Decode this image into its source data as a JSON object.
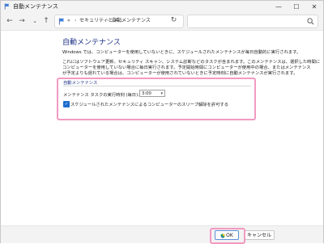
{
  "window": {
    "title": "自動メンテナンス",
    "icon": "flag-icon",
    "controls": {
      "minimize": "—",
      "maximize": "☐",
      "close": "✕"
    }
  },
  "nav": {
    "back": "←",
    "forward": "→",
    "recent": "⌄",
    "up": "↑",
    "breadcrumb": [
      "«",
      "セキュリティとメ...",
      "自動メンテナンス"
    ],
    "breadcrumb_separator": "›",
    "address_dropdown": "⌄",
    "refresh": "↻",
    "search_placeholder": ""
  },
  "content": {
    "heading": "自動メンテナンス",
    "paragraph1": "Windows では、コンピューターを使用していないときに、スケジュールされたメンテナンスが毎日自動的に実行されます。",
    "paragraph2_lines": [
      "これにはソフトウェア更新、セキュリティ スキャン、システム診断などのタスクが含まれます。このメンテナンスは、選択した時間に",
      "コンピューターを使用していない場合に毎日実行されます。予定開始時間にコンピューターが使用中の場合、またはメンテナンス",
      "が予定よりも遅れている場合は、コンピューターが使用されていないときに予定時刻に自動メンテナンスが実行されます。"
    ],
    "group": {
      "title": "自動メンテナンス",
      "time_label": "メンテナンス タスクの実行時刻 (毎日):",
      "time_value": "3:00",
      "wake_checked": true,
      "wake_label": "スケジュールされたメンテナンスによるコンピューターのスリープ解除を許可する"
    }
  },
  "footer": {
    "ok_label": "OK",
    "cancel_label": "キャンセル"
  },
  "colors": {
    "heading": "#1e3287",
    "highlight": "#f29ac2",
    "checkbox": "#1e6ecf"
  }
}
